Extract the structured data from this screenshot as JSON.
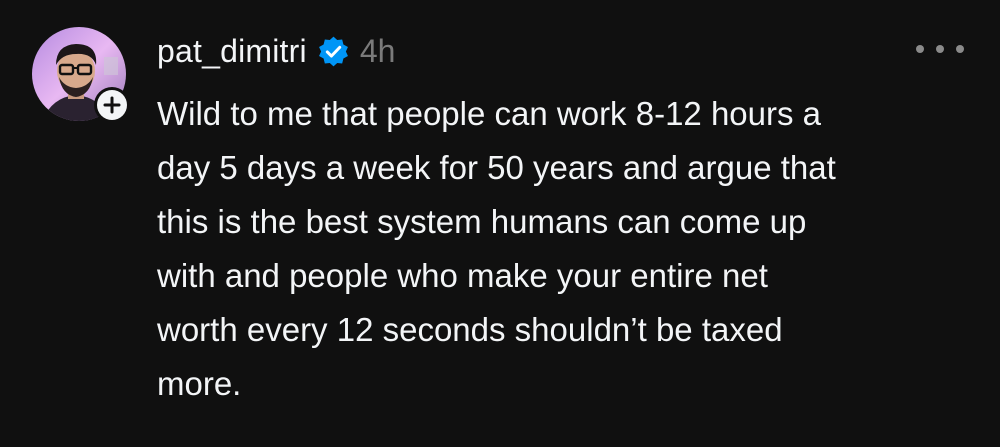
{
  "post": {
    "author": {
      "username": "pat_dimitri",
      "verified": true,
      "avatar_icon": "profile-photo"
    },
    "time": "4h",
    "follow_icon": "plus-icon",
    "more_icon": "more-horizontal-icon",
    "text": "Wild to me that people can work 8-12 hours a\nday 5 days a week for 50 years and argue that\nthis is the best system humans can come up\nwith and people who make your entire net\nworth every 12 seconds shouldn’t be taxed\nmore."
  },
  "colors": {
    "background": "#101010",
    "text": "#f3f5f7",
    "muted": "#7a7a7a",
    "verified": "#0095f6"
  }
}
